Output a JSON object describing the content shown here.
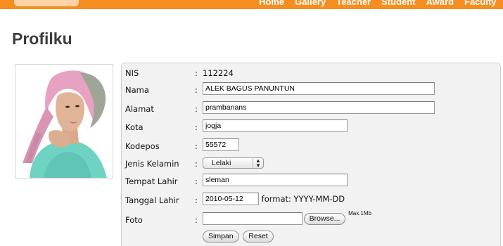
{
  "nav": {
    "items": [
      "Home",
      "Gallery",
      "Teacher",
      "Student",
      "Award",
      "Faculty"
    ]
  },
  "page": {
    "title": "Profilku"
  },
  "form": {
    "colon": ":",
    "nis": {
      "label": "NIS",
      "value": "112224"
    },
    "nama": {
      "label": "Nama",
      "value": "ALEK BAGUS PANUNTUN"
    },
    "alamat": {
      "label": "Alamat",
      "value": "prambanans"
    },
    "kota": {
      "label": "Kota",
      "value": "jogja"
    },
    "kodepos": {
      "label": "Kodepos",
      "value": "55572"
    },
    "jenis_kelamin": {
      "label": "Jenis Kelamin",
      "value": "Lelaki"
    },
    "tempat_lahir": {
      "label": "Tempat Lahir",
      "value": "sleman"
    },
    "tanggal_lahir": {
      "label": "Tanggal Lahir",
      "value": "2010-05-12",
      "format_hint": "format: YYYY-MM-DD"
    },
    "foto": {
      "label": "Foto",
      "browse_label": "Browse...",
      "max_note": "Max.1Mb"
    },
    "buttons": {
      "simpan": "Simpan",
      "reset": "Reset"
    }
  },
  "colors": {
    "nav_orange": "#f78d1e",
    "title": "#3d3d3d",
    "panel_bg": "#f2f2f2"
  },
  "icons": {
    "select_arrow": "updown-arrows-icon"
  }
}
